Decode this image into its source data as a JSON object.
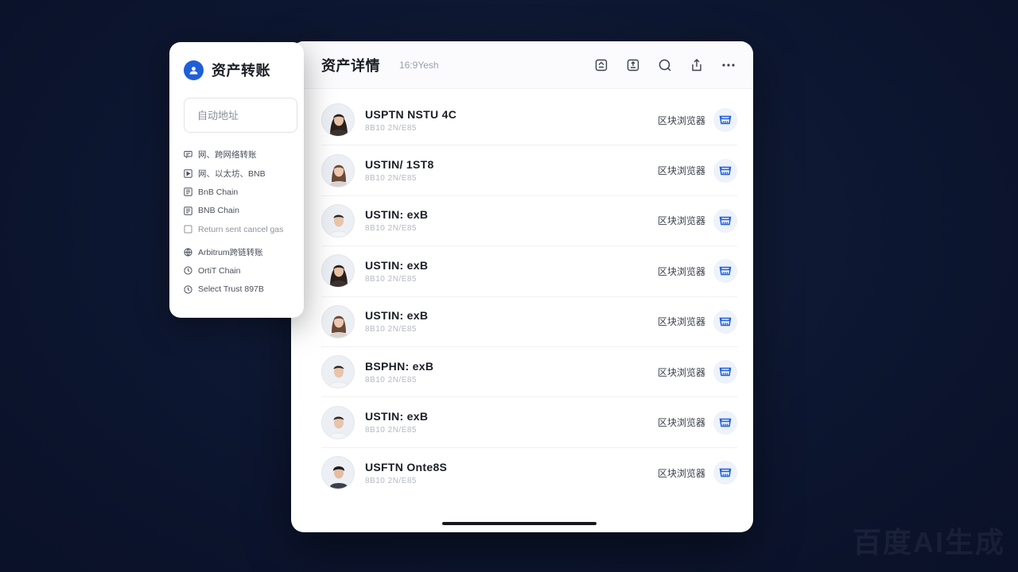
{
  "side": {
    "title": "资产转账",
    "input_placeholder": "自动地址",
    "items": [
      {
        "label": "网、跨网络转账",
        "icon": "message-icon"
      },
      {
        "label": "网、以太坊、BNB",
        "icon": "play-square-icon"
      },
      {
        "label": "BnB Chain",
        "icon": "chain-box-icon"
      },
      {
        "label": "BNB Chain",
        "icon": "chain-box-icon"
      },
      {
        "label": "Return sent cancel gas",
        "icon": "square-icon"
      },
      {
        "label": "Arbitrum跨链转账",
        "icon": "globe-icon"
      },
      {
        "label": "OrtiT Chain",
        "icon": "clock-icon"
      },
      {
        "label": "Select Trust 897B",
        "icon": "clock-icon"
      }
    ]
  },
  "main": {
    "title": "资产详情",
    "subtitle": "16:9Yesh",
    "header_icons": [
      "copy-icon",
      "share-box-icon",
      "search-icon",
      "export-icon",
      "more-icon"
    ],
    "rows": [
      {
        "name": "USPTN NSTU 4C",
        "sub": "8B10 2N/E85",
        "explorer": "区块浏览器",
        "avatar": "woman-long-hair-avatar"
      },
      {
        "name": "USTIN/ 1ST8",
        "sub": "8B10 2N/E85",
        "explorer": "区块浏览器",
        "avatar": "woman-avatar"
      },
      {
        "name": "USTIN: exB",
        "sub": "8B10 2N/E85",
        "explorer": "区块浏览器",
        "avatar": "man-avatar"
      },
      {
        "name": "USTIN: exB",
        "sub": "8B10 2N/E85",
        "explorer": "区块浏览器",
        "avatar": "woman-long-hair-avatar"
      },
      {
        "name": "USTIN: exB",
        "sub": "8B10 2N/E85",
        "explorer": "区块浏览器",
        "avatar": "woman-avatar"
      },
      {
        "name": "BSPHN: exB",
        "sub": "8B10 2N/E85",
        "explorer": "区块浏览器",
        "avatar": "man-avatar"
      },
      {
        "name": "USTIN: exB",
        "sub": "8B10 2N/E85",
        "explorer": "区块浏览器",
        "avatar": "man-avatar"
      },
      {
        "name": "USFTN Onte8S",
        "sub": "8B10 2N/E85",
        "explorer": "区块浏览器",
        "avatar": "man-dark-hair-avatar"
      }
    ]
  },
  "colors": {
    "accent": "#1e5fd8",
    "background": "#0d1630"
  },
  "watermark": "百度AI生成"
}
